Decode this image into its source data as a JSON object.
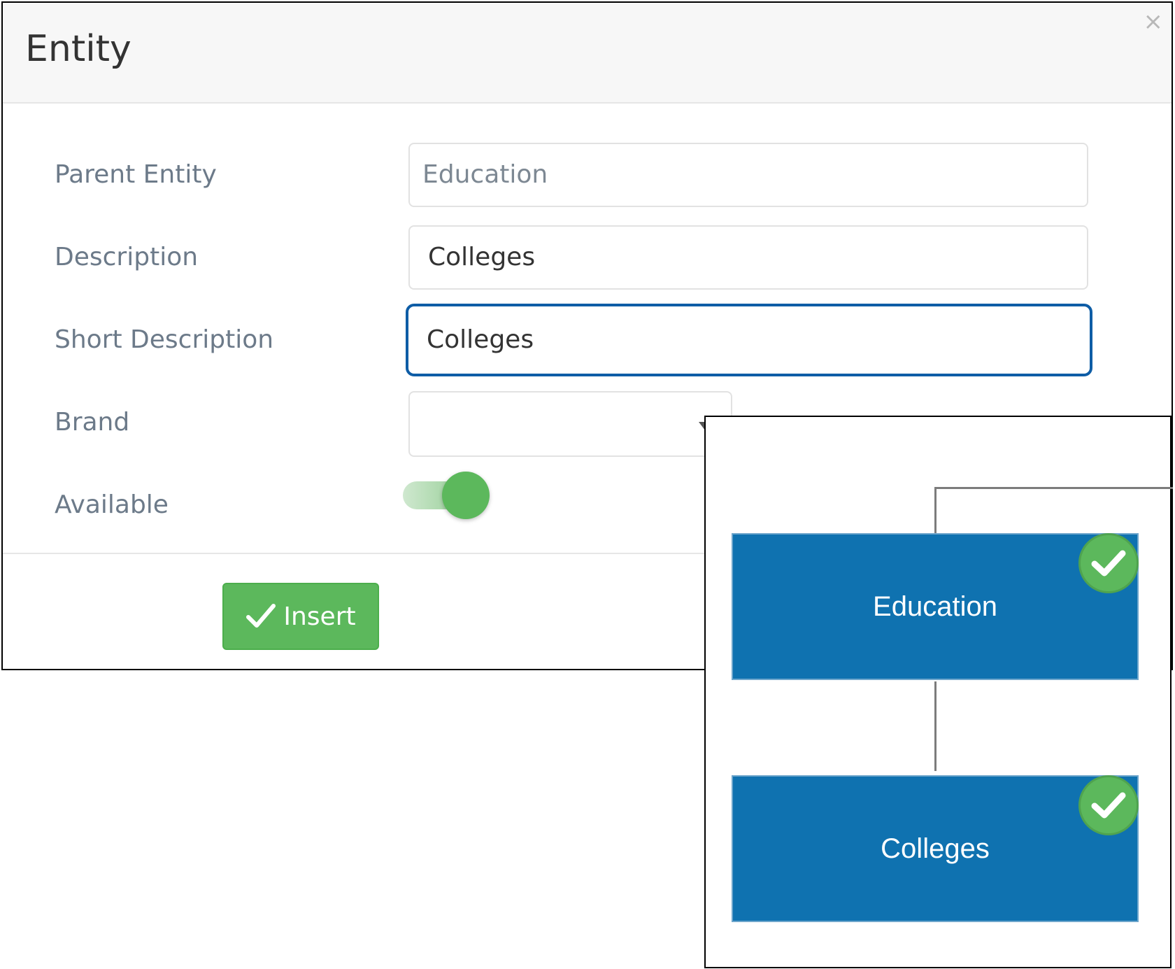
{
  "modal": {
    "title": "Entity",
    "close_symbol": "×",
    "fields": {
      "parent_entity": {
        "label": "Parent Entity",
        "value": "Education"
      },
      "description": {
        "label": "Description",
        "value": "Colleges"
      },
      "short_description": {
        "label": "Short Description",
        "value": "Colleges"
      },
      "brand": {
        "label": "Brand",
        "value": ""
      },
      "available": {
        "label": "Available",
        "on": true
      }
    },
    "insert_label": "Insert"
  },
  "hierarchy": {
    "nodes": [
      {
        "label": "Education",
        "status_icon": "check-circle-icon"
      },
      {
        "label": "Colleges",
        "status_icon": "check-circle-icon"
      }
    ]
  },
  "colors": {
    "accent_green": "#5cb85c",
    "node_blue": "#0f72b0",
    "focus_blue": "#0e5da6"
  }
}
